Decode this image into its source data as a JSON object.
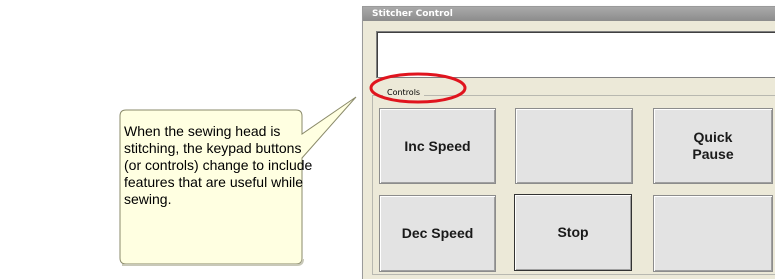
{
  "window": {
    "title": "Stitcher Control"
  },
  "display": {
    "text": ""
  },
  "controls": {
    "group_label": "Controls",
    "buttons": {
      "inc_speed": "Inc Speed",
      "empty_top": "",
      "quick_pause": "Quick\nPause",
      "dec_speed": "Dec Speed",
      "stop": "Stop",
      "empty_bottom": ""
    }
  },
  "callout": {
    "text": "When the sewing head is stitching, the keypad buttons (or controls) change to include features that are useful while sewing."
  },
  "colors": {
    "callout_fill": "#ffffe1",
    "highlight_ring": "#e0141e",
    "dialog_bg": "#ece9d8"
  }
}
